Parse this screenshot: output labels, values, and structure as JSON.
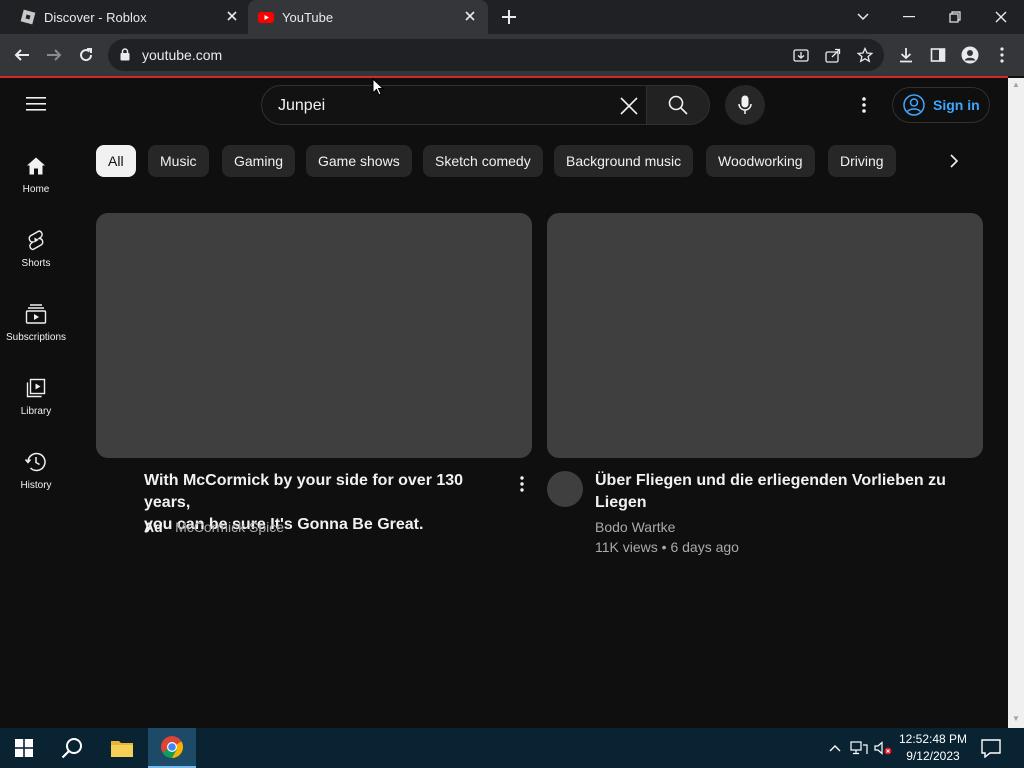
{
  "browser": {
    "tabs": [
      {
        "title": "Discover - Roblox"
      },
      {
        "title": "YouTube"
      }
    ],
    "url": "youtube.com"
  },
  "youtube": {
    "search_value": "Junpei",
    "signin_label": "Sign in",
    "sidebar": [
      {
        "label": "Home",
        "icon": "home-icon"
      },
      {
        "label": "Shorts",
        "icon": "shorts-icon"
      },
      {
        "label": "Subscriptions",
        "icon": "subscriptions-icon"
      },
      {
        "label": "Library",
        "icon": "library-icon"
      },
      {
        "label": "History",
        "icon": "history-icon"
      }
    ],
    "chips": [
      "All",
      "Music",
      "Gaming",
      "Game shows",
      "Sketch comedy",
      "Background music",
      "Woodworking",
      "Driving"
    ],
    "videos": [
      {
        "title_line1": "With McCormick by your side for over 130 years,",
        "title_line2": "you can be sure It's Gonna Be Great.",
        "ad_badge": "Ad",
        "channel": "McCormick Spice"
      },
      {
        "title_line1": "Über Fliegen und die erliegenden Vorlieben zu",
        "title_line2": "Liegen",
        "channel": "Bodo Wartke",
        "stats": "11K views • 6 days ago"
      }
    ]
  },
  "taskbar": {
    "time": "12:52:48 PM",
    "date": "9/12/2023"
  },
  "colors": {
    "accent_blue": "#3ea6ff",
    "youtube_red": "#ff0000",
    "background": "#0f0f0f"
  }
}
